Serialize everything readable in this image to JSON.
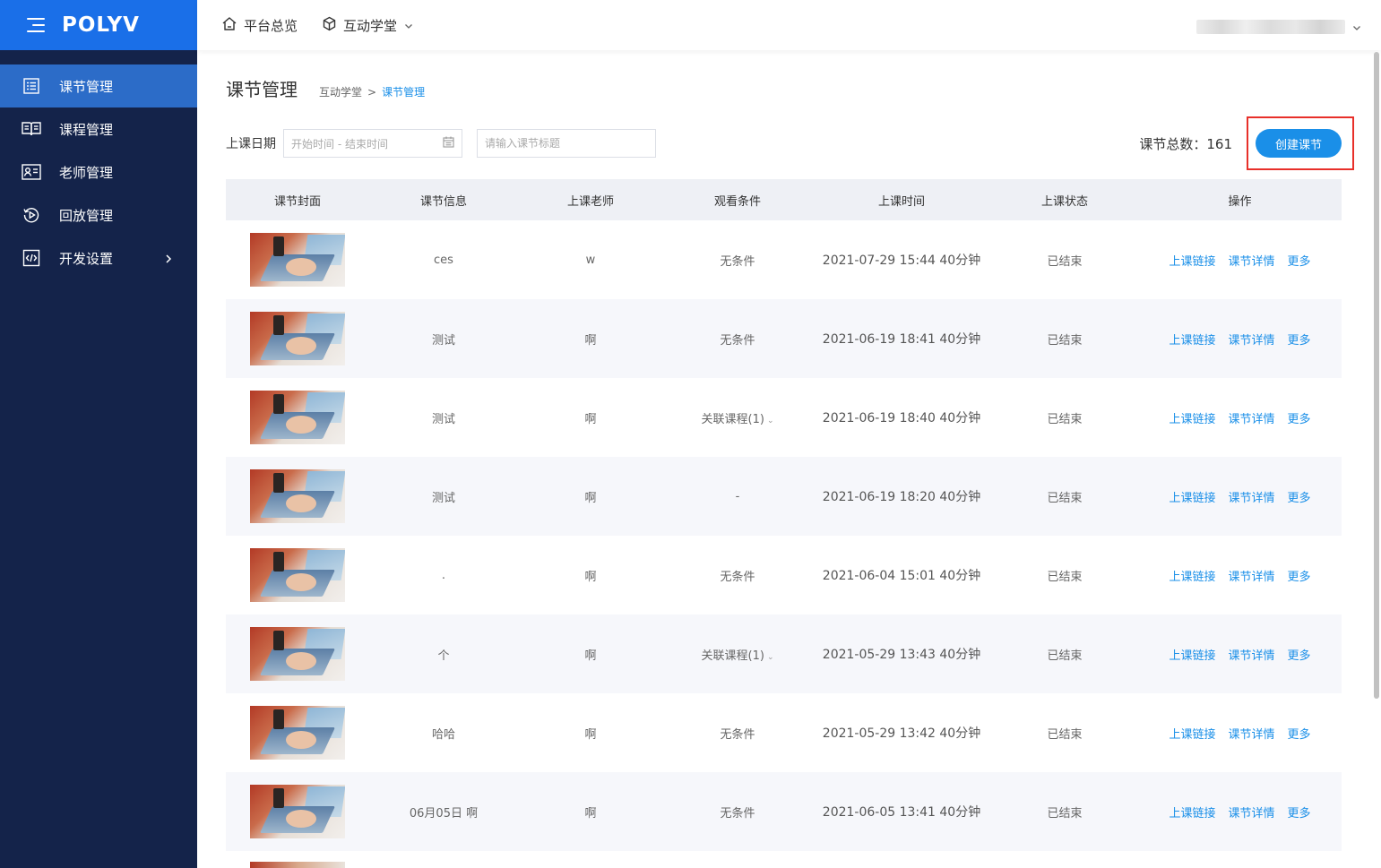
{
  "logo": {
    "text": "POLYV"
  },
  "sidebar": {
    "items": [
      {
        "label": "课节管理",
        "icon": "list-icon"
      },
      {
        "label": "课程管理",
        "icon": "book-icon"
      },
      {
        "label": "老师管理",
        "icon": "id-card-icon"
      },
      {
        "label": "回放管理",
        "icon": "replay-icon"
      },
      {
        "label": "开发设置",
        "icon": "code-icon"
      }
    ]
  },
  "topbar": {
    "overview": "平台总览",
    "classroom": "互动学堂"
  },
  "page": {
    "title": "课节管理",
    "breadcrumb_parent": "互动学堂",
    "breadcrumb_sep": ">",
    "breadcrumb_current": "课节管理"
  },
  "filter": {
    "date_label": "上课日期",
    "date_placeholder": "开始时间 - 结束时间",
    "title_placeholder": "请输入课节标题"
  },
  "summary": {
    "count_label": "课节总数：161",
    "create_button": "创建课节"
  },
  "table": {
    "headers": [
      "课节封面",
      "课节信息",
      "上课老师",
      "观看条件",
      "上课时间",
      "上课状态",
      "操作"
    ],
    "ops": {
      "link": "上课链接",
      "detail": "课节详情",
      "more": "更多"
    },
    "rows": [
      {
        "info": "ces",
        "teacher": "w",
        "condition": "无条件",
        "time": "2021-07-29 15:44  40分钟",
        "status": "已结束"
      },
      {
        "info": "测试",
        "teacher": "啊",
        "condition": "无条件",
        "time": "2021-06-19 18:41  40分钟",
        "status": "已结束"
      },
      {
        "info": "测试",
        "teacher": "啊",
        "condition": "关联课程(1)",
        "time": "2021-06-19 18:40  40分钟",
        "status": "已结束"
      },
      {
        "info": "测试",
        "teacher": "啊",
        "condition": "-",
        "time": "2021-06-19 18:20  40分钟",
        "status": "已结束"
      },
      {
        "info": ".",
        "teacher": "啊",
        "condition": "无条件",
        "time": "2021-06-04 15:01  40分钟",
        "status": "已结束"
      },
      {
        "info": "个",
        "teacher": "啊",
        "condition": "关联课程(1)",
        "time": "2021-05-29 13:43  40分钟",
        "status": "已结束"
      },
      {
        "info": "哈哈",
        "teacher": "啊",
        "condition": "无条件",
        "time": "2021-05-29 13:42  40分钟",
        "status": "已结束"
      },
      {
        "info": "06月05日 啊",
        "teacher": "啊",
        "condition": "无条件",
        "time": "2021-06-05 13:41  40分钟",
        "status": "已结束"
      }
    ]
  },
  "colors": {
    "brand": "#1a6fe8",
    "sidebar": "#14234a",
    "active": "#2c6cc8",
    "link": "#1a8fe8",
    "highlight": "#e8302a"
  }
}
